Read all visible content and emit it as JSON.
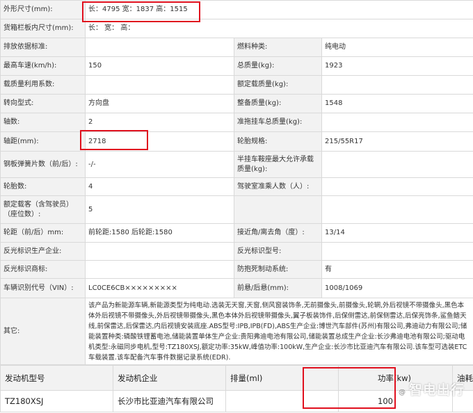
{
  "spec_rows": [
    [
      "外形尺寸(mm):",
      "长：4795 宽：1837 高：1515"
    ],
    [
      "货箱栏板内尺寸(mm):",
      "长：  宽：  高："
    ],
    [
      "排放依据标准:",
      "",
      "燃料种类:",
      "纯电动"
    ],
    [
      "最高车速(km/h):",
      "150",
      "总质量(kg):",
      "1923"
    ],
    [
      "载质量利用系数:",
      "",
      "额定载质量(kg):",
      ""
    ],
    [
      "转向型式:",
      "方向盘",
      "整备质量(kg):",
      "1548"
    ],
    [
      "轴数:",
      "2",
      "准拖挂车总质量(kg):",
      ""
    ],
    [
      "轴距(mm):",
      "2718",
      "轮胎规格:",
      "215/55R17"
    ],
    [
      "钢板弹簧片数（前/后）:",
      "-/-",
      "半挂车鞍座最大允许承载质量(kg):",
      ""
    ],
    [
      "轮胎数:",
      "4",
      "驾驶室准乘人数（人）:",
      ""
    ],
    [
      "额定载客（含驾驶员）（座位数）:",
      "5",
      "",
      ""
    ],
    [
      "轮距（前/后）mm:",
      "前轮距:1580 后轮距:1580",
      "接近角/离去角（度）:",
      "13/14"
    ],
    [
      "反光标识生产企业:",
      "",
      "反光标识型号:",
      ""
    ],
    [
      "反光标识商标:",
      "",
      "防抱死制动系统:",
      "有"
    ],
    [
      "车辆识别代号（VIN）:",
      "LC0CE6CB×××××××××",
      "前悬/后悬(mm):",
      "1008/1069"
    ]
  ],
  "other": {
    "label": "其它:",
    "text": "该产品为新能源车辆,新能源类型为纯电动.选装无天窗,天窗,侧风窗装饰条,无前摄像头,前摄像头,轮辋,外后视镜不带摄像头,黑色本体外后视镜不带摄像头,外后视镜带摄像头,黑色本体外后视镜带摄像头,翼子板装饰件,后保侧雷达,前保侧雷达,后保亮饰条,鲨鱼鳍天线,前保雷达,后保雷达,内后视镜安装底座.ABS型号:IPB,IPB(FD),ABS生产企业:博世汽车部件(苏州)有限公司,弗迪动力有限公司;储能装置种类:磷酸铁锂蓄电池,储能装置单体生产企业:贵阳弗迪电池有限公司,储能装置总成生产企业:长沙弗迪电池有限公司;驱动电机类型:永磁同步电机,型号:TZ180XSJ,额定功率:35kW,峰值功率:100kW,生产企业:长沙市比亚迪汽车有限公司.该车型可选装ETC车载装置.该车配备汽车事件数据记录系统(EDR)."
  },
  "engine_table": {
    "headers": [
      "发动机型号",
      "发动机企业",
      "排量(ml)",
      "功率(kw)",
      "油耗"
    ],
    "row": [
      "TZ180XSJ",
      "长沙市比亚迪汽车有限公司",
      "",
      "100",
      ""
    ]
  },
  "watermark": {
    "prefix": "@",
    "text": "智电出行"
  },
  "colors": {
    "label_bg": "#f2f2f2",
    "border": "#d9d9d9",
    "highlight": "#e0101e"
  }
}
